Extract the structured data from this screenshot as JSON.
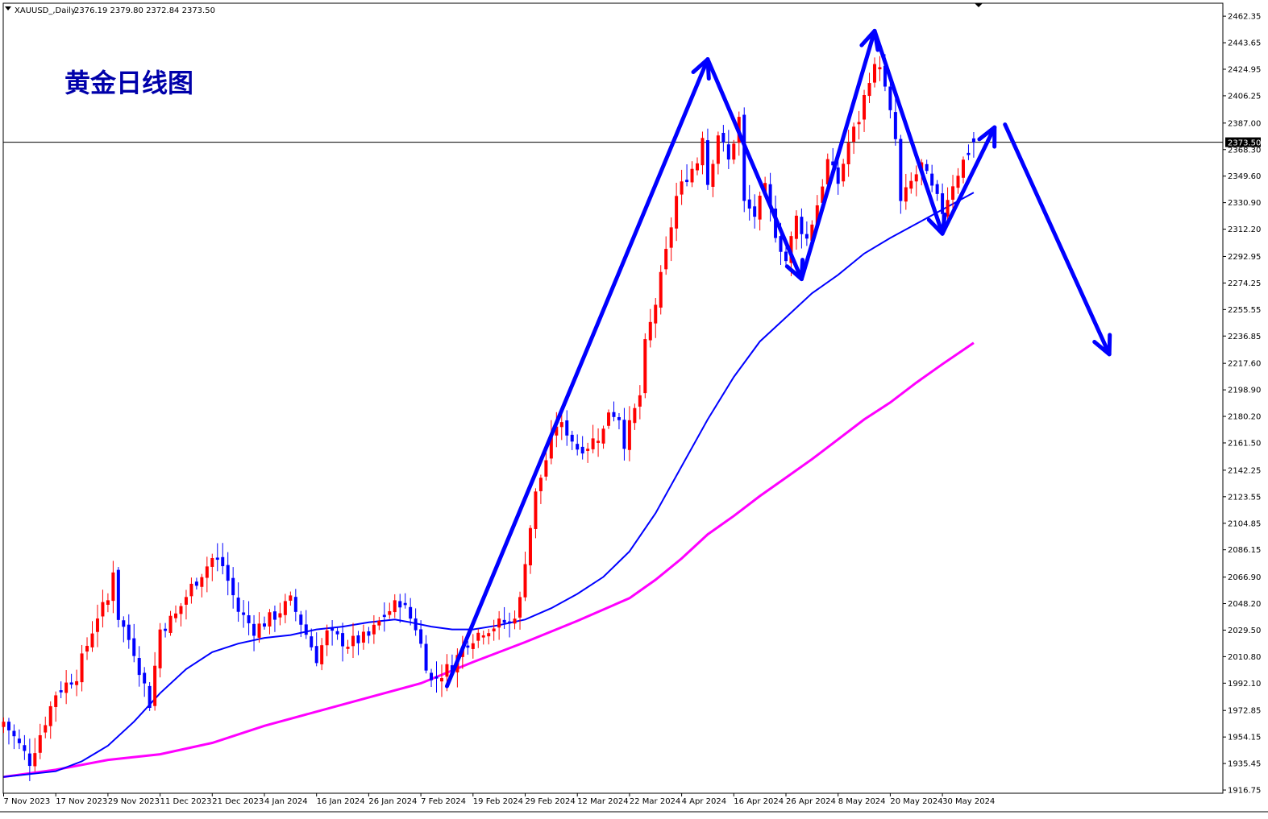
{
  "header": {
    "symbol": "XAUUSD_,Daily",
    "ohlc": "2376.19 2379.80 2372.84 2373.50"
  },
  "annotation_title": "黄金日线图",
  "current_price_label": "2373.50",
  "colors": {
    "bull": "#ff0000",
    "bear": "#0000ff",
    "ma_fast": "#0000ff",
    "ma_slow": "#ff00ff",
    "arrows": "#0000ff",
    "title": "#0000aa"
  },
  "chart_data": {
    "type": "candlestick",
    "title": "黄金日线图",
    "y_axis": {
      "ticks": [
        "2462.35",
        "2443.65",
        "2424.95",
        "2406.25",
        "2387.00",
        "2368.30",
        "2349.60",
        "2330.90",
        "2312.20",
        "2292.95",
        "2274.25",
        "2255.55",
        "2236.85",
        "2217.60",
        "2198.90",
        "2180.20",
        "2161.50",
        "2142.25",
        "2123.55",
        "2104.85",
        "2086.15",
        "2066.90",
        "2048.20",
        "2029.50",
        "2010.80",
        "1992.10",
        "1972.85",
        "1954.15",
        "1935.45",
        "1916.75"
      ],
      "range": [
        1914.5,
        2471.5
      ]
    },
    "x_axis": {
      "ticks": [
        "7 Nov 2023",
        "17 Nov 2023",
        "29 Nov 2023",
        "11 Dec 2023",
        "21 Dec 2023",
        "4 Jan 2024",
        "16 Jan 2024",
        "26 Jan 2024",
        "7 Feb 2024",
        "19 Feb 2024",
        "29 Feb 2024",
        "12 Mar 2024",
        "22 Mar 2024",
        "4 Apr 2024",
        "16 Apr 2024",
        "26 Apr 2024",
        "8 May 2024",
        "20 May 2024",
        "30 May 2024"
      ],
      "tick_bar_index": [
        0,
        10,
        20,
        30,
        40,
        50,
        60,
        70,
        80,
        90,
        100,
        110,
        120,
        130,
        140,
        150,
        160,
        170,
        180
      ]
    },
    "close_anchors": [
      [
        0,
        1965
      ],
      [
        5,
        1937
      ],
      [
        10,
        1985
      ],
      [
        14,
        1998
      ],
      [
        18,
        2040
      ],
      [
        20,
        2050
      ],
      [
        21,
        2073
      ],
      [
        22,
        2039
      ],
      [
        25,
        2015
      ],
      [
        28,
        1978
      ],
      [
        30,
        2030
      ],
      [
        33,
        2040
      ],
      [
        36,
        2060
      ],
      [
        38,
        2070
      ],
      [
        40,
        2080
      ],
      [
        42,
        2075
      ],
      [
        45,
        2043
      ],
      [
        48,
        2030
      ],
      [
        52,
        2040
      ],
      [
        55,
        2050
      ],
      [
        57,
        2035
      ],
      [
        60,
        2010
      ],
      [
        62,
        2027
      ],
      [
        66,
        2020
      ],
      [
        70,
        2025
      ],
      [
        73,
        2040
      ],
      [
        76,
        2050
      ],
      [
        79,
        2032
      ],
      [
        82,
        1993
      ],
      [
        86,
        2005
      ],
      [
        89,
        2022
      ],
      [
        92,
        2030
      ],
      [
        96,
        2035
      ],
      [
        97,
        2033
      ],
      [
        99,
        2050
      ],
      [
        100,
        2080
      ],
      [
        102,
        2125
      ],
      [
        104,
        2150
      ],
      [
        106,
        2175
      ],
      [
        108,
        2170
      ],
      [
        110,
        2158
      ],
      [
        112,
        2160
      ],
      [
        115,
        2170
      ],
      [
        116,
        2185
      ],
      [
        118,
        2180
      ],
      [
        119,
        2162
      ],
      [
        122,
        2195
      ],
      [
        123,
        2230
      ],
      [
        125,
        2260
      ],
      [
        127,
        2295
      ],
      [
        129,
        2335
      ],
      [
        131,
        2350
      ],
      [
        133,
        2360
      ],
      [
        134,
        2380
      ],
      [
        135,
        2345
      ],
      [
        137,
        2380
      ],
      [
        139,
        2360
      ],
      [
        141,
        2390
      ],
      [
        142,
        2330
      ],
      [
        144,
        2322
      ],
      [
        146,
        2340
      ],
      [
        148,
        2310
      ],
      [
        150,
        2290
      ],
      [
        152,
        2320
      ],
      [
        154,
        2305
      ],
      [
        156,
        2330
      ],
      [
        158,
        2360
      ],
      [
        160,
        2345
      ],
      [
        162,
        2373
      ],
      [
        164,
        2390
      ],
      [
        166,
        2420
      ],
      [
        168,
        2430
      ],
      [
        169,
        2410
      ],
      [
        171,
        2375
      ],
      [
        172,
        2330
      ],
      [
        174,
        2345
      ],
      [
        176,
        2357
      ],
      [
        178,
        2340
      ],
      [
        180,
        2325
      ],
      [
        182,
        2345
      ],
      [
        184,
        2360
      ],
      [
        186,
        2373.5
      ]
    ],
    "ma_fast": [
      [
        0,
        1926
      ],
      [
        10,
        1930
      ],
      [
        15,
        1937
      ],
      [
        20,
        1948
      ],
      [
        25,
        1965
      ],
      [
        30,
        1985
      ],
      [
        35,
        2002
      ],
      [
        40,
        2014
      ],
      [
        45,
        2020
      ],
      [
        50,
        2024
      ],
      [
        55,
        2026
      ],
      [
        60,
        2030
      ],
      [
        65,
        2032
      ],
      [
        70,
        2035
      ],
      [
        75,
        2037
      ],
      [
        78,
        2035
      ],
      [
        82,
        2032
      ],
      [
        86,
        2030
      ],
      [
        90,
        2030
      ],
      [
        95,
        2033
      ],
      [
        100,
        2037
      ],
      [
        105,
        2045
      ],
      [
        110,
        2055
      ],
      [
        115,
        2067
      ],
      [
        120,
        2085
      ],
      [
        125,
        2112
      ],
      [
        130,
        2145
      ],
      [
        135,
        2178
      ],
      [
        140,
        2208
      ],
      [
        145,
        2233
      ],
      [
        150,
        2250
      ],
      [
        155,
        2267
      ],
      [
        160,
        2280
      ],
      [
        165,
        2295
      ],
      [
        170,
        2306
      ],
      [
        175,
        2316
      ],
      [
        180,
        2326
      ],
      [
        186,
        2338
      ]
    ],
    "ma_slow": [
      [
        0,
        1926
      ],
      [
        10,
        1931
      ],
      [
        20,
        1938
      ],
      [
        30,
        1942
      ],
      [
        40,
        1950
      ],
      [
        50,
        1962
      ],
      [
        60,
        1972
      ],
      [
        70,
        1982
      ],
      [
        80,
        1992
      ],
      [
        90,
        2007
      ],
      [
        100,
        2021
      ],
      [
        110,
        2036
      ],
      [
        120,
        2052
      ],
      [
        125,
        2065
      ],
      [
        130,
        2080
      ],
      [
        135,
        2097
      ],
      [
        140,
        2110
      ],
      [
        145,
        2124
      ],
      [
        150,
        2137
      ],
      [
        155,
        2150
      ],
      [
        160,
        2164
      ],
      [
        165,
        2178
      ],
      [
        170,
        2190
      ],
      [
        175,
        2204
      ],
      [
        180,
        2217
      ],
      [
        186,
        2232
      ]
    ],
    "arrows": [
      {
        "from": [
          85,
          1990
        ],
        "to": [
          135,
          2432
        ]
      },
      {
        "from": [
          135,
          2432
        ],
        "to": [
          153,
          2277
        ]
      },
      {
        "from": [
          153,
          2277
        ],
        "to": [
          167,
          2452
        ]
      },
      {
        "from": [
          167,
          2452
        ],
        "to": [
          180,
          2309
        ]
      },
      {
        "from": [
          180,
          2309
        ],
        "to": [
          190,
          2384
        ]
      },
      {
        "from": [
          192,
          2386
        ],
        "to": [
          212,
          2224
        ]
      }
    ],
    "current_price": 2373.5
  }
}
